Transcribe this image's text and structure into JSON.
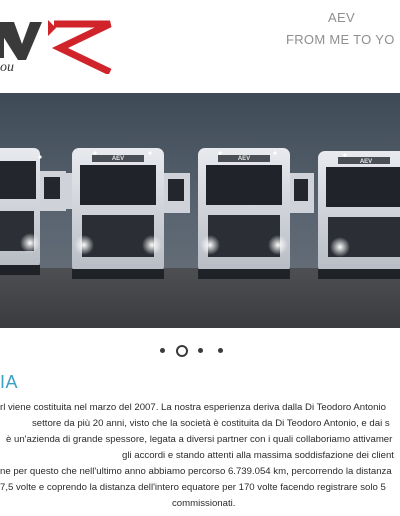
{
  "header": {
    "logo_tagline": "ou",
    "brand_name": "AEV",
    "brand_slogan": "FROM ME TO YO"
  },
  "hero": {
    "truck_badge": "AEV",
    "carousel": {
      "count": 4,
      "active": 2
    }
  },
  "section": {
    "title": "IA",
    "lines": [
      "rl viene costituita nel marzo del 2007. La nostra esperienza deriva dalla Di Teodoro Antonio",
      "settore da più 20 anni, visto che la società è costituita da Di Teodoro Antonio, e dai s",
      "è un'azienda di grande spessore, legata a diversi partner con i quali collaboriamo attivamer",
      "gli accordi e stando attenti alla massima soddisfazione dei client",
      "ne per questo che nell'ultimo anno abbiamo percorso 6.739.054 km, percorrendo la distanza",
      "7,5 volte e coprendo la distanza dell'intero equatore per 170 volte facendo registrare solo 5",
      "commissionati."
    ]
  },
  "colors": {
    "accent": "#3aa0c4",
    "logo_red": "#d1232a",
    "text": "#2b2b2b",
    "muted": "#8f8f8f"
  }
}
